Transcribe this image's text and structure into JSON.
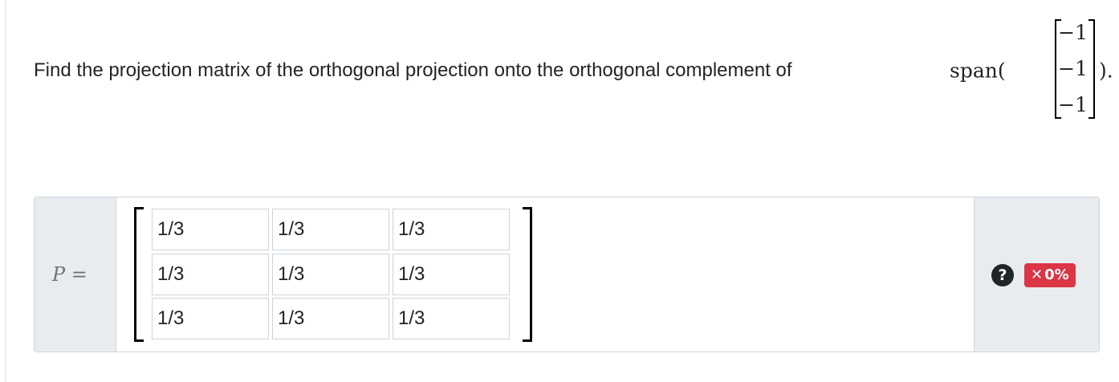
{
  "question": {
    "prompt": "Find the projection matrix of the orthogonal projection onto the orthogonal complement of",
    "span_label": "span(",
    "vector": [
      "−1",
      "−1",
      "−1"
    ],
    "close": ")."
  },
  "answer": {
    "matrix_var": "P",
    "equals": "=",
    "cells": [
      [
        "1/3",
        "1/3",
        "1/3"
      ],
      [
        "1/3",
        "1/3",
        "1/3"
      ],
      [
        "1/3",
        "1/3",
        "1/3"
      ]
    ]
  },
  "status": {
    "help_icon": "question-circle-icon",
    "help_glyph": "?",
    "score_icon": "x-icon",
    "score_glyph": "✕",
    "score": "0%",
    "score_color": "#dc3545"
  }
}
